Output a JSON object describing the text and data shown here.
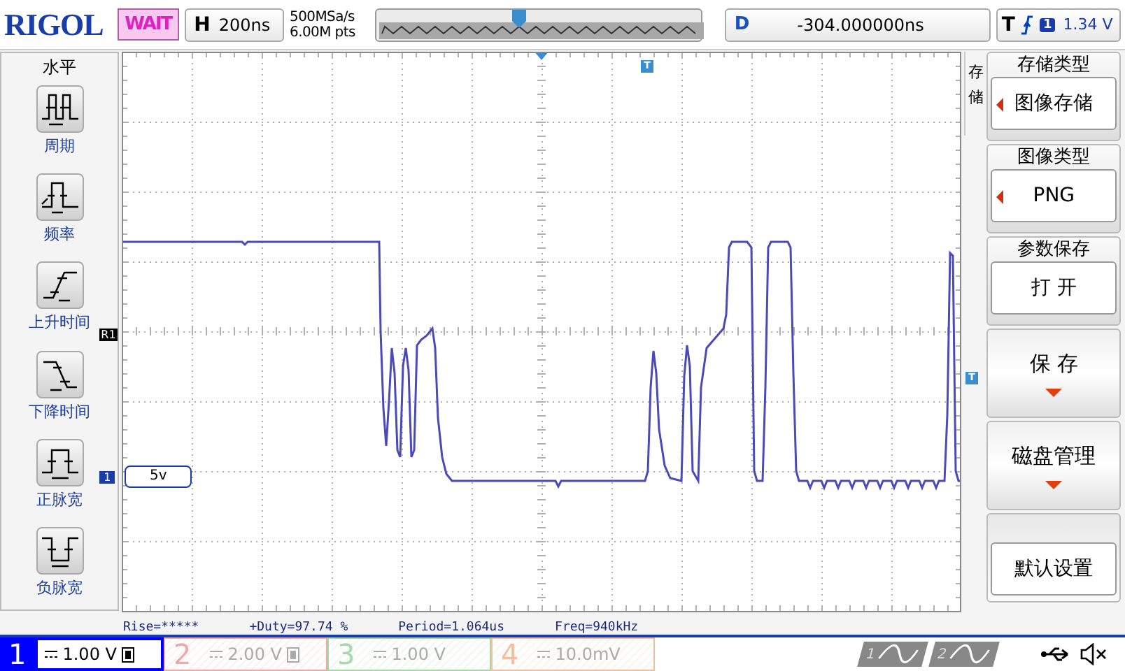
{
  "top_bar": {
    "logo": "RIGOL",
    "run_status": "WAIT",
    "horizontal": {
      "label": "H",
      "value": "200ns"
    },
    "sample_rate": "500MSa/s",
    "memory_depth": "6.00M pts",
    "delay": {
      "label": "D",
      "value": "-304.000000ns"
    },
    "trigger": {
      "label": "T",
      "channel": "1",
      "level": "1.34 V"
    }
  },
  "left_menu": {
    "title": "水平",
    "items": [
      {
        "kind": "period",
        "label": "周期"
      },
      {
        "kind": "frequency",
        "label": "频率"
      },
      {
        "kind": "rise",
        "label": "上升时间"
      },
      {
        "kind": "fall",
        "label": "下降时间"
      },
      {
        "kind": "pos_width",
        "label": "正脉宽"
      },
      {
        "kind": "neg_width",
        "label": "负脉宽"
      }
    ]
  },
  "screen": {
    "ref_marker": "R1",
    "channel_marker": "1",
    "scale_label": "5v",
    "trigger_marker": "T",
    "trigger_level_marker": "T"
  },
  "measurements": [
    "Rise=*****",
    "+Duty=97.74 %",
    "Period=1.064us",
    "Freq=940kHz"
  ],
  "right_menu": {
    "title": "存储",
    "items": [
      {
        "kind": "option",
        "title": "存储类型",
        "value": "图像存储",
        "arrow": true
      },
      {
        "kind": "option",
        "title": "图像类型",
        "value": "PNG",
        "arrow": true
      },
      {
        "kind": "option",
        "title": "参数保存",
        "value": "打 开",
        "arrow": false
      },
      {
        "kind": "submenu",
        "label": "保 存"
      },
      {
        "kind": "submenu",
        "label": "磁盘管理"
      },
      {
        "kind": "action",
        "label": "默认设置"
      }
    ]
  },
  "channels": [
    {
      "number": "1",
      "scale": "1.00 V",
      "active": true,
      "color": "#0000ff",
      "extra_icon": true
    },
    {
      "number": "2",
      "scale": "2.00 V",
      "active": false,
      "color": "#f0a8a8",
      "extra_icon": true
    },
    {
      "number": "3",
      "scale": "1.00 V",
      "active": false,
      "color": "#a8d8a8",
      "extra_icon": false
    },
    {
      "number": "4",
      "scale": "10.0mV",
      "active": false,
      "color": "#f0c0a0",
      "extra_icon": false
    }
  ],
  "math": [
    {
      "number": "1"
    },
    {
      "number": "2"
    }
  ]
}
